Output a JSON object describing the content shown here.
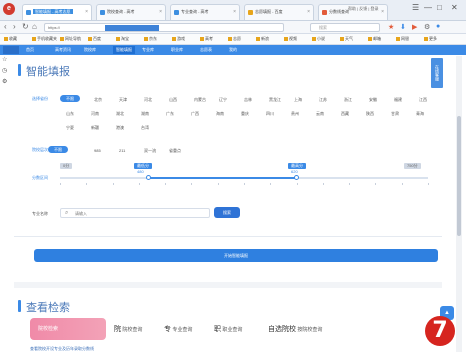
{
  "browser": {
    "logo": "e",
    "tabs": [
      {
        "label": "智能填报 - 高考志愿",
        "active": true,
        "color": "#3d8fe0"
      },
      {
        "label": "院校查询 - 高考",
        "active": false,
        "color": "#3d8fe0"
      },
      {
        "label": "专业查询 - 高考",
        "active": false,
        "color": "#3d8fe0"
      },
      {
        "label": "志愿填报 - 百度",
        "active": false,
        "color": "#e7a51b"
      },
      {
        "label": "分数线查询",
        "active": false,
        "color": "#e25b3a"
      }
    ],
    "tab_close": "×",
    "window_controls": [
      "☰",
      "—",
      "□",
      "✕"
    ],
    "url_text": "https://",
    "search_placeholder": "搜索",
    "nav": {
      "back": "‹",
      "forward": "›",
      "refresh": "↻",
      "home": "⌂"
    },
    "bookmarks": [
      "收藏",
      "手机收藏夹",
      "网址导航",
      "百度",
      "淘宝",
      "京东",
      "游戏",
      "高考",
      "志愿",
      "新浪",
      "视频",
      "小说",
      "天气",
      "邮箱",
      "网银",
      "更多"
    ]
  },
  "site_nav": {
    "items": [
      "首页",
      "高考资讯",
      "院校库",
      "智能填报",
      "专业库",
      "职业库",
      "志愿表",
      "我的"
    ]
  },
  "panel": {
    "title": "智能填报",
    "header_links": "帮助 | 反馈 | 登录",
    "right_tab": "在线客服",
    "province": {
      "label": "选择省份",
      "active": "不限",
      "options": [
        "北京",
        "天津",
        "河北",
        "山西",
        "内蒙古",
        "辽宁",
        "吉林",
        "黑龙江",
        "上海",
        "江苏",
        "浙江",
        "安徽",
        "福建",
        "江西",
        "山东",
        "河南",
        "湖北",
        "湖南",
        "广东",
        "广西",
        "海南",
        "重庆",
        "四川",
        "贵州",
        "云南",
        "西藏",
        "陕西",
        "甘肃",
        "青海",
        "宁夏",
        "新疆",
        "港澳",
        "台湾"
      ]
    },
    "level": {
      "label": "院校层次",
      "active": "不限",
      "options": [
        "985",
        "211",
        "双一流",
        "省重点"
      ]
    },
    "score": {
      "label": "分数区间",
      "low_tip": "最低分",
      "high_tip": "最高分",
      "min": "0分",
      "max": "750分",
      "left_value": "480",
      "right_value": "620",
      "range_low": 0.24,
      "range_high": 0.64
    },
    "search": {
      "label": "专业名称",
      "placeholder": "请输入",
      "button": "搜索"
    },
    "submit_button": "开始智能填报"
  },
  "query": {
    "title": "查看检索",
    "tabs": [
      {
        "label": "院校检索",
        "active": true
      },
      {
        "icon": "院",
        "label": "院校查询",
        "active": false
      },
      {
        "icon": "专",
        "label": "专业查询",
        "active": false
      },
      {
        "icon": "职",
        "label": "职业查询",
        "active": false
      },
      {
        "icon": "自选院校",
        "label": "按院校查询",
        "active": false
      }
    ],
    "hint_line": "查看院校开设专业及历年录取分数线"
  },
  "back_to_top": "▲",
  "step_badge": "7",
  "colors": {
    "accent": "#3b8ae6",
    "badge": "#d6251f",
    "pink": "#f08aa8"
  }
}
